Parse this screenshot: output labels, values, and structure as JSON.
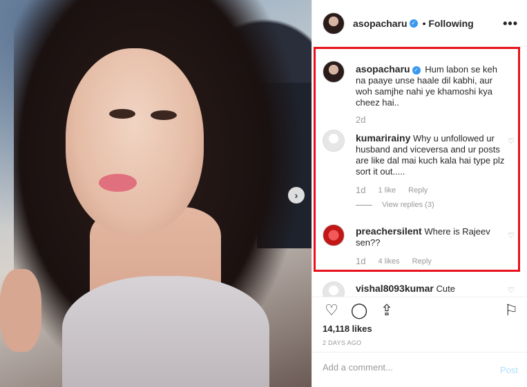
{
  "post": {
    "username": "asopacharu",
    "following_label": "• Following",
    "more_icon": "more-horizontal-icon"
  },
  "comments": [
    {
      "username": "asopacharu",
      "text": "Hum labon se keh na paaye unse haale dil kabhi, aur woh samjhe nahi ye khamoshi kya cheez hai..",
      "time": "2d",
      "verified": true
    },
    {
      "username": "kumarirainy",
      "text": "Why u unfollowed ur husband and viceversa and ur posts are like dal mai kuch kala hai type plz sort it out.....",
      "time": "1d",
      "likes": "1 like",
      "reply": "Reply",
      "view_replies": "View replies (3)"
    },
    {
      "username": "preachersilent",
      "text": "Where is Rajeev sen??",
      "time": "1d",
      "likes": "4 likes",
      "reply": "Reply"
    },
    {
      "username": "vishal8093kumar",
      "text": "Cute"
    }
  ],
  "actions": {
    "likes_count": "14,118 likes",
    "posted_ago": "2 DAYS AGO"
  },
  "composer": {
    "placeholder": "Add a comment...",
    "post_label": "Post"
  },
  "colors": {
    "highlight_border": "#e8101a",
    "verified_badge": "#3897f0",
    "post_button": "#b2dffc"
  }
}
